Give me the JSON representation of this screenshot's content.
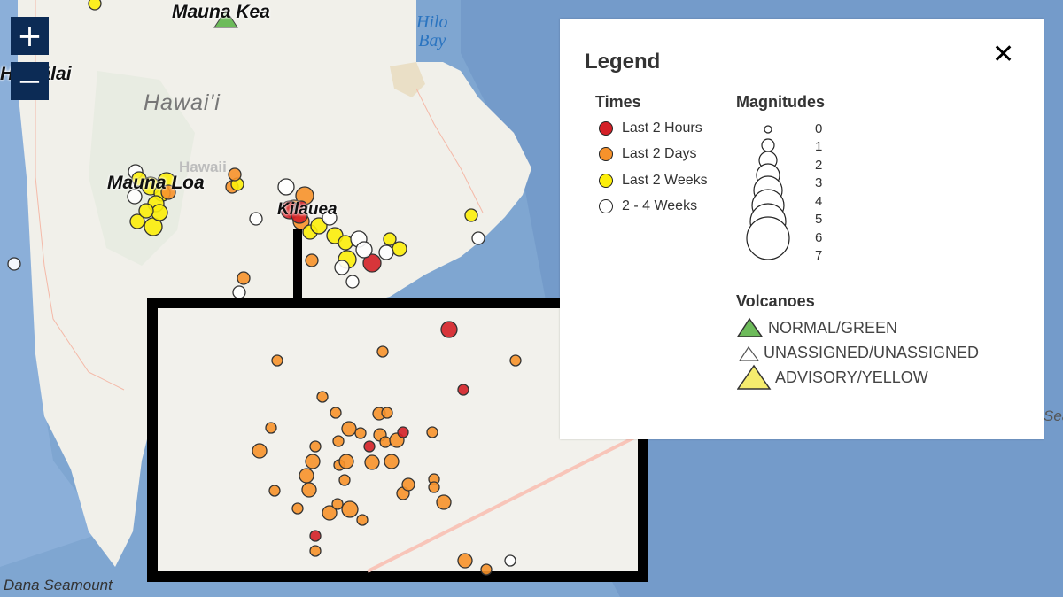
{
  "map": {
    "labels": {
      "mauna_kea": "Mauna Kea",
      "hualalai": "Hualālai",
      "hawaii_island": "Hawai'i",
      "hawaii_faint": "Hawaii",
      "mauna_loa": "Mauna Loa",
      "kilauea": "Kilauea",
      "hilo_bay_line1": "Hilo",
      "hilo_bay_line2": "Bay",
      "dana_seamount": "Dana Seamount",
      "edge_sea": "Sea"
    },
    "controls": {
      "zoom_in": "+",
      "zoom_out": "−"
    },
    "colors": {
      "last_2_hours": "#d42027",
      "last_2_days": "#f7922b",
      "last_2_weeks": "#fcee0a",
      "two_to_four_weeks": "#ffffff",
      "volcano_normal": "#6dbb5a",
      "volcano_advisory": "#f5ec6e",
      "zoom_button": "#0c2b55",
      "ocean": "#7fa6d1",
      "land": "#f1f0ea"
    }
  },
  "legend": {
    "title": "Legend",
    "close_label": "✕",
    "times": {
      "title": "Times",
      "items": [
        {
          "label": "Last 2 Hours",
          "color": "#d42027"
        },
        {
          "label": "Last 2 Days",
          "color": "#f7922b"
        },
        {
          "label": "Last 2 Weeks",
          "color": "#fcee0a"
        },
        {
          "label": "2 - 4 Weeks",
          "color": "#ffffff"
        }
      ]
    },
    "magnitudes": {
      "title": "Magnitudes",
      "values": [
        "0",
        "1",
        "2",
        "3",
        "4",
        "5",
        "6",
        "7"
      ]
    },
    "volcanoes": {
      "title": "Volcanoes",
      "items": [
        {
          "label": "NORMAL/GREEN",
          "color": "#6dbb5a"
        },
        {
          "label": "UNASSIGNED/UNASSIGNED",
          "color": "#ffffff"
        },
        {
          "label": "ADVISORY/YELLOW",
          "color": "#f5ec6e"
        }
      ]
    }
  }
}
